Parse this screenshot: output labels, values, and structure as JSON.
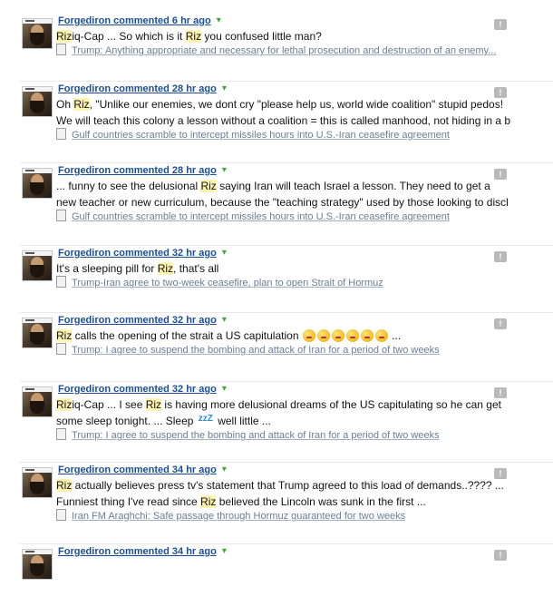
{
  "comments": [
    {
      "author": "Forgediron commented 6 hr ago",
      "segments": [
        {
          "text": "Riz",
          "hl": true
        },
        {
          "text": "iq-Cap ... So which is it ",
          "hl": false
        },
        {
          "text": "Riz",
          "hl": true
        },
        {
          "text": " you confused little man?",
          "hl": false
        }
      ],
      "source": "Trump: Anything appropriate and necessary for lethal prosecution and destruction of an enemy..."
    },
    {
      "author": "Forgediron commented 28 hr ago",
      "segments": [
        {
          "text": "Oh ",
          "hl": false
        },
        {
          "text": "Riz",
          "hl": true
        },
        {
          "text": ", \"Unlike our enemies, we dont cry \"please help us, world wide coalition\" stupid pedos!",
          "hl": false
        },
        {
          "text": "\n",
          "hl": false
        },
        {
          "text": "We will teach this colony a lesson without a coalition = this is called manhood, not hiding in a b",
          "hl": false
        }
      ],
      "source": "Gulf countries scramble to intercept missiles hours into U.S.-Iran ceasefire agreement"
    },
    {
      "author": "Forgediron commented 28 hr ago",
      "segments": [
        {
          "text": "... funny to see the delusional ",
          "hl": false
        },
        {
          "text": "Riz",
          "hl": true
        },
        {
          "text": " saying Iran will teach Israel a lesson. They need to get a",
          "hl": false
        },
        {
          "text": "\n",
          "hl": false
        },
        {
          "text": "new teacher or new curriculum, because the \"teaching strategy\" used by those looking to discl",
          "hl": false
        }
      ],
      "source": "Gulf countries scramble to intercept missiles hours into U.S.-Iran ceasefire agreement"
    },
    {
      "author": "Forgediron commented 32 hr ago",
      "segments": [
        {
          "text": "It's a sleeping pill for ",
          "hl": false
        },
        {
          "text": "Riz",
          "hl": true
        },
        {
          "text": ", that's all",
          "hl": false
        }
      ],
      "source": "Trump-Iran agree to two-week ceasefire, plan to open Strait of Hormuz"
    },
    {
      "author": "Forgediron commented 32 hr ago",
      "segments": [
        {
          "text": "Riz",
          "hl": true
        },
        {
          "text": " calls the opening of the strait a US capitulation ",
          "hl": false
        },
        {
          "emoji": 6
        },
        {
          "text": " ...",
          "hl": false
        }
      ],
      "source": "Trump: I agree to suspend the bombing and attack of Iran for a period of two weeks"
    },
    {
      "author": "Forgediron commented 32 hr ago",
      "segments": [
        {
          "text": "Riz",
          "hl": true
        },
        {
          "text": "iq-Cap ... I see ",
          "hl": false
        },
        {
          "text": "Riz",
          "hl": true
        },
        {
          "text": " is having more delusional dreams of the US capitulating so he can get",
          "hl": false
        },
        {
          "text": "\n",
          "hl": false
        },
        {
          "text": "some sleep tonight. ... Sleep ",
          "hl": false
        },
        {
          "zz": "zzZ"
        },
        {
          "text": " well little ...",
          "hl": false
        }
      ],
      "source": "Trump: I agree to suspend the bombing and attack of Iran for a period of two weeks"
    },
    {
      "author": "Forgediron commented 34 hr ago",
      "segments": [
        {
          "text": "Riz",
          "hl": true
        },
        {
          "text": " actually believes press tv's statement that Trump agreed to this load of demands..???? ...",
          "hl": false
        },
        {
          "text": "\n",
          "hl": false
        },
        {
          "text": "Funniest thing I've read since ",
          "hl": false
        },
        {
          "text": "Riz",
          "hl": true
        },
        {
          "text": " believed the Lincoln was sunk in the first ...",
          "hl": false
        }
      ],
      "source": "Iran FM Araghchi: Safe passage through Hormuz guaranteed for two weeks"
    },
    {
      "author": "Forgediron commented 34 hr ago",
      "segments": [],
      "source": ""
    }
  ],
  "icons": {
    "avatar": "user-avatar",
    "arrow": "dropdown-arrow-icon",
    "doc": "document-icon",
    "flag": "report-flag-icon"
  },
  "colors": {
    "author": "#1a4f96",
    "highlight": "#fff3b0",
    "arrow": "#3aa835",
    "source": "#6a7e95"
  }
}
